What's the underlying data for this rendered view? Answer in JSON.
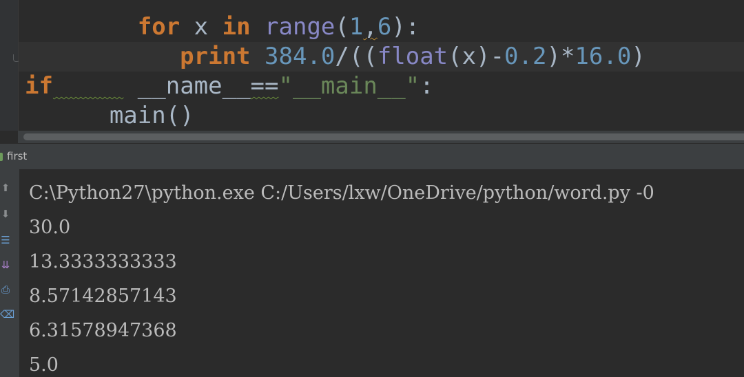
{
  "editor": {
    "lines": [
      {
        "indent": "        ",
        "tokens": [
          {
            "text": "for",
            "cls": "kw"
          },
          {
            "text": " x ",
            "cls": "plain"
          },
          {
            "text": "in",
            "cls": "kw"
          },
          {
            "text": " range",
            "cls": "builtin"
          },
          {
            "text": "(",
            "cls": "plain"
          },
          {
            "text": "1",
            "cls": "num"
          },
          {
            "text": ",",
            "cls": "squiggle"
          },
          {
            "text": "6",
            "cls": "num"
          },
          {
            "text": "):",
            "cls": "plain"
          }
        ]
      },
      {
        "indent": "           ",
        "tokens": [
          {
            "text": "print",
            "cls": "kw"
          },
          {
            "text": " ",
            "cls": "plain"
          },
          {
            "text": "384.0",
            "cls": "num"
          },
          {
            "text": "/((",
            "cls": "plain"
          },
          {
            "text": "float",
            "cls": "builtin"
          },
          {
            "text": "(x)-",
            "cls": "plain"
          },
          {
            "text": "0.2",
            "cls": "num"
          },
          {
            "text": ")*",
            "cls": "plain"
          },
          {
            "text": "16.0",
            "cls": "num"
          },
          {
            "text": ")",
            "cls": "plain"
          }
        ]
      },
      {
        "indent": "",
        "tokens": [
          {
            "text": "if",
            "cls": "kw"
          },
          {
            "text": "     ",
            "cls": "squiggle-green"
          },
          {
            "text": " __name__",
            "cls": "dunder"
          },
          {
            "text": "==",
            "cls": "squiggle-green"
          },
          {
            "text": "\"__main__\"",
            "cls": "str"
          },
          {
            "text": ":",
            "cls": "plain"
          }
        ]
      },
      {
        "indent": "      ",
        "tokens": [
          {
            "text": "main()",
            "cls": "plain"
          }
        ]
      }
    ]
  },
  "run_panel": {
    "tab_label": "first",
    "toolbar_icons": [
      "up-arrow-icon",
      "down-arrow-icon",
      "soft-wrap-icon",
      "scroll-to-end-icon",
      "print-icon",
      "trash-icon"
    ],
    "console_lines": [
      "C:\\Python27\\python.exe C:/Users/lxw/OneDrive/python/word.py -0",
      "30.0",
      "13.3333333333",
      "8.57142857143",
      "6.31578947368",
      "5.0"
    ]
  },
  "colors": {
    "keyword": "#cc7832",
    "builtin": "#8888c6",
    "number": "#6897bb",
    "string": "#6a8759",
    "text": "#a9b7c6",
    "background": "#2b2b2b"
  }
}
